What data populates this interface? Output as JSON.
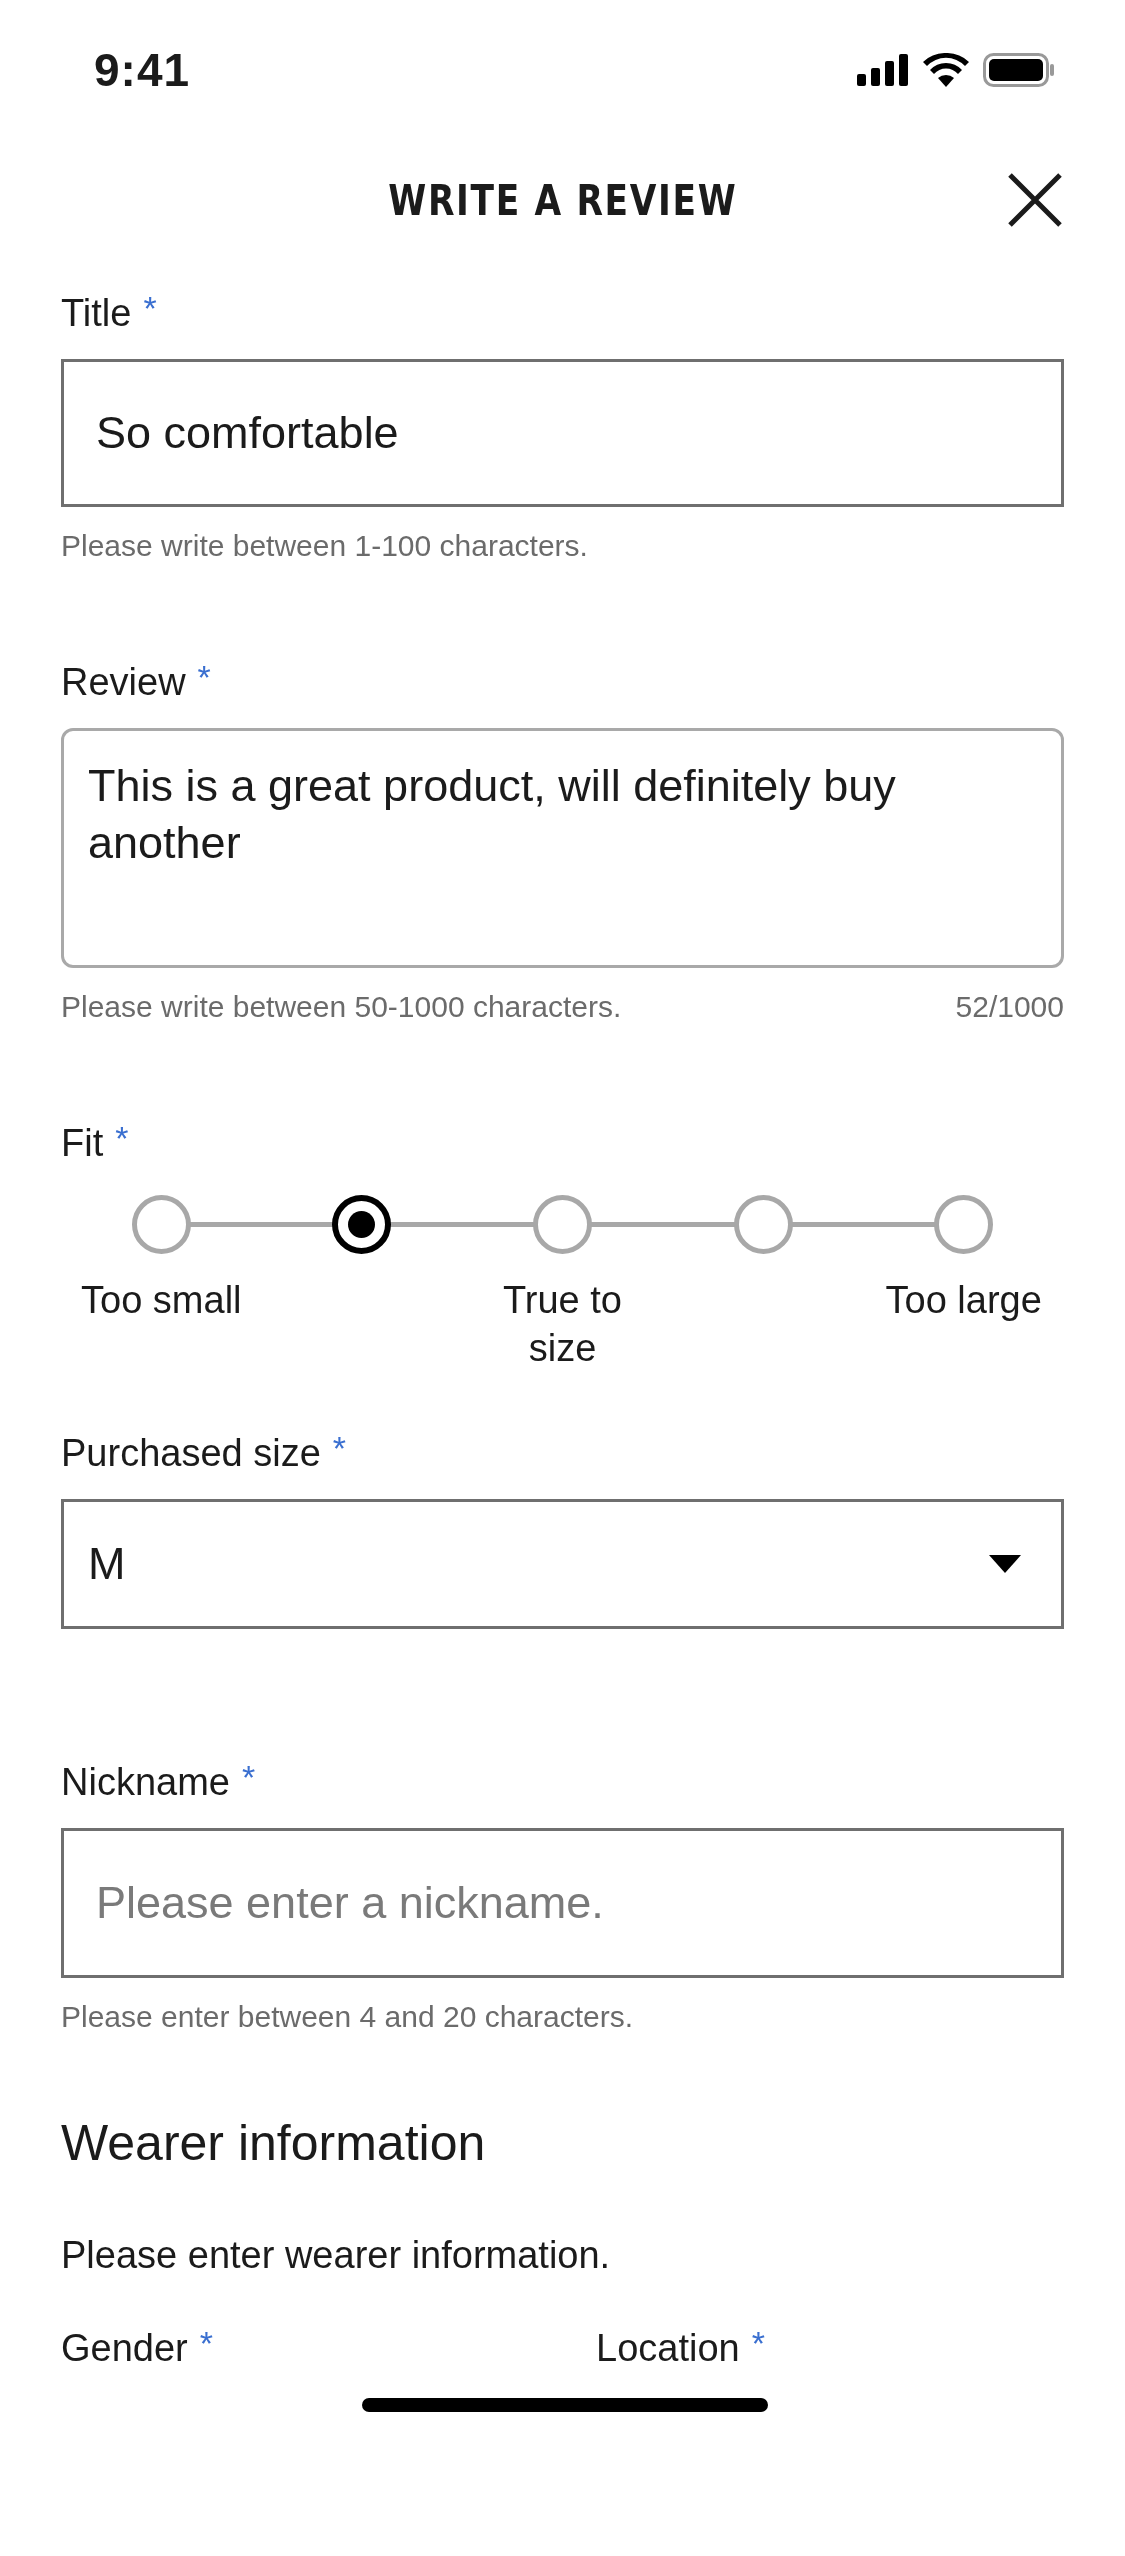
{
  "status_bar": {
    "time": "9:41"
  },
  "header": {
    "title": "WRITE A REVIEW"
  },
  "title_field": {
    "label": "Title",
    "required_mark": "*",
    "value": "So comfortable",
    "hint": "Please write between 1-100 characters."
  },
  "review_field": {
    "label": "Review",
    "required_mark": "*",
    "value": "This is a great product, will definitely buy another",
    "hint": "Please write between 50-1000 characters.",
    "counter": "52/1000"
  },
  "fit": {
    "label": "Fit",
    "required_mark": "*",
    "options": [
      {
        "label": "Too small",
        "selected": false
      },
      {
        "selected": true
      },
      {
        "label": "True to size",
        "selected": false
      },
      {
        "selected": false
      },
      {
        "label": "Too large",
        "selected": false
      }
    ]
  },
  "purchased_size": {
    "label": "Purchased size",
    "required_mark": "*",
    "value": "M"
  },
  "nickname_field": {
    "label": "Nickname",
    "required_mark": "*",
    "placeholder": "Please enter a nickname.",
    "hint": "Please enter between 4 and 20 characters."
  },
  "wearer_information": {
    "heading": "Wearer information",
    "description": "Please enter wearer information.",
    "fields": [
      {
        "label": "Gender",
        "required_mark": "*"
      },
      {
        "label": "Location",
        "required_mark": "*"
      }
    ]
  }
}
